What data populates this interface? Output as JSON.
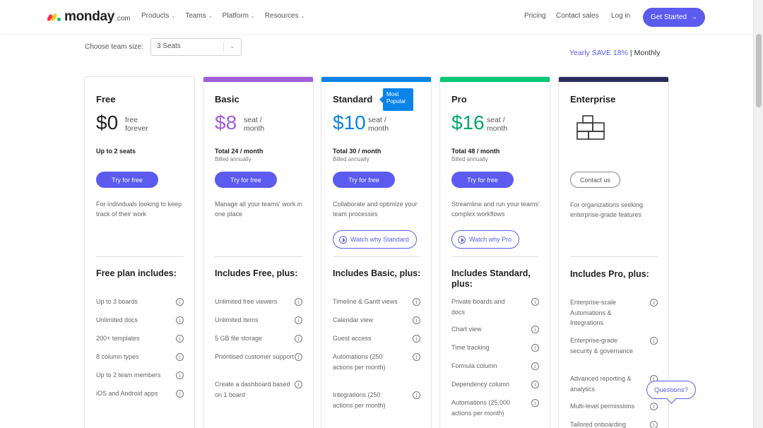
{
  "header": {
    "logo_text": "monday",
    "logo_suffix": ".com",
    "nav": [
      {
        "label": "Products"
      },
      {
        "label": "Teams"
      },
      {
        "label": "Platform"
      },
      {
        "label": "Resources"
      }
    ],
    "pricing": "Pricing",
    "contact_sales": "Contact sales",
    "login": "Log in",
    "get_started": "Get Started",
    "get_started_icon": "arrow-right-icon",
    "accent_color": "#5b5bf0"
  },
  "controls": {
    "team_size_label": "Choose team size:",
    "team_size_value": "3 Seats",
    "billing_yearly": "Yearly SAVE 18%",
    "billing_separator": "|",
    "billing_monthly": "Monthly"
  },
  "plans": [
    {
      "name": "Free",
      "price": "$0",
      "unit_line1": "free",
      "unit_line2": "forever",
      "total": "Up to 2 seats",
      "billed": "",
      "cta": "Try for free",
      "description": "For individuals looking to keep track of their work",
      "includes": "Free plan includes:",
      "bar_color": "#ffffff",
      "features": [
        "Up to 3 boards",
        "Unlimited docs",
        "200+ templates",
        "8 column types",
        "Up to 2 team members",
        "iOS and Android apps"
      ]
    },
    {
      "name": "Basic",
      "price": "$8",
      "unit_line1": "seat /",
      "unit_line2": "month",
      "total": "Total 24 / month",
      "billed": "Billed annually",
      "cta": "Try for free",
      "description": "Manage all your teams' work in one place",
      "includes": "Includes Free, plus:",
      "bar_color": "#a25ddc",
      "features": [
        "Unlimited free viewers",
        "Unlimited items",
        "5 GB file storage",
        "Prioritised customer support",
        "Create a dashboard based on 1 board"
      ]
    },
    {
      "name": "Standard",
      "badge": "Most Popular",
      "price": "$10",
      "unit_line1": "seat /",
      "unit_line2": "month",
      "total": "Total 30 / month",
      "billed": "Billed annually",
      "cta": "Try for free",
      "description": "Collaborate and optimize your team processes",
      "watch": "Watch why Standard",
      "includes": "Includes Basic, plus:",
      "bar_color": "#0a84e8",
      "features": [
        "Timeline & Gantt views",
        "Calendar view",
        "Guest access",
        "Automations (250 actions per month)",
        "Integrations (250 actions per month)"
      ]
    },
    {
      "name": "Pro",
      "price": "$16",
      "unit_line1": "seat /",
      "unit_line2": "month",
      "total": "Total 48 / month",
      "billed": "Billed annually",
      "cta": "Try for free",
      "description": "Streamline and run your teams' complex workflows",
      "watch": "Watch why Pro",
      "includes": "Includes Standard, plus:",
      "bar_color": "#00c875",
      "features": [
        "Private boards and docs",
        "Chart view",
        "Time tracking",
        "Formula column",
        "Dependency column",
        "Automations (25,000 actions per month)"
      ]
    },
    {
      "name": "Enterprise",
      "price": "",
      "cta": "Contact us",
      "description": "For organizations seeking enterprise-grade features",
      "includes": "Includes Pro, plus:",
      "bar_color": "#2b2c5c",
      "icon": "building-blocks-icon",
      "features": [
        "Enterprise-scale Automations & Integrations",
        "Enterprise-grade security & governance",
        "Advanced reporting & analytics",
        "Multi-level permissions",
        "Tailored onboarding"
      ]
    }
  ],
  "questions_label": "Questions?"
}
